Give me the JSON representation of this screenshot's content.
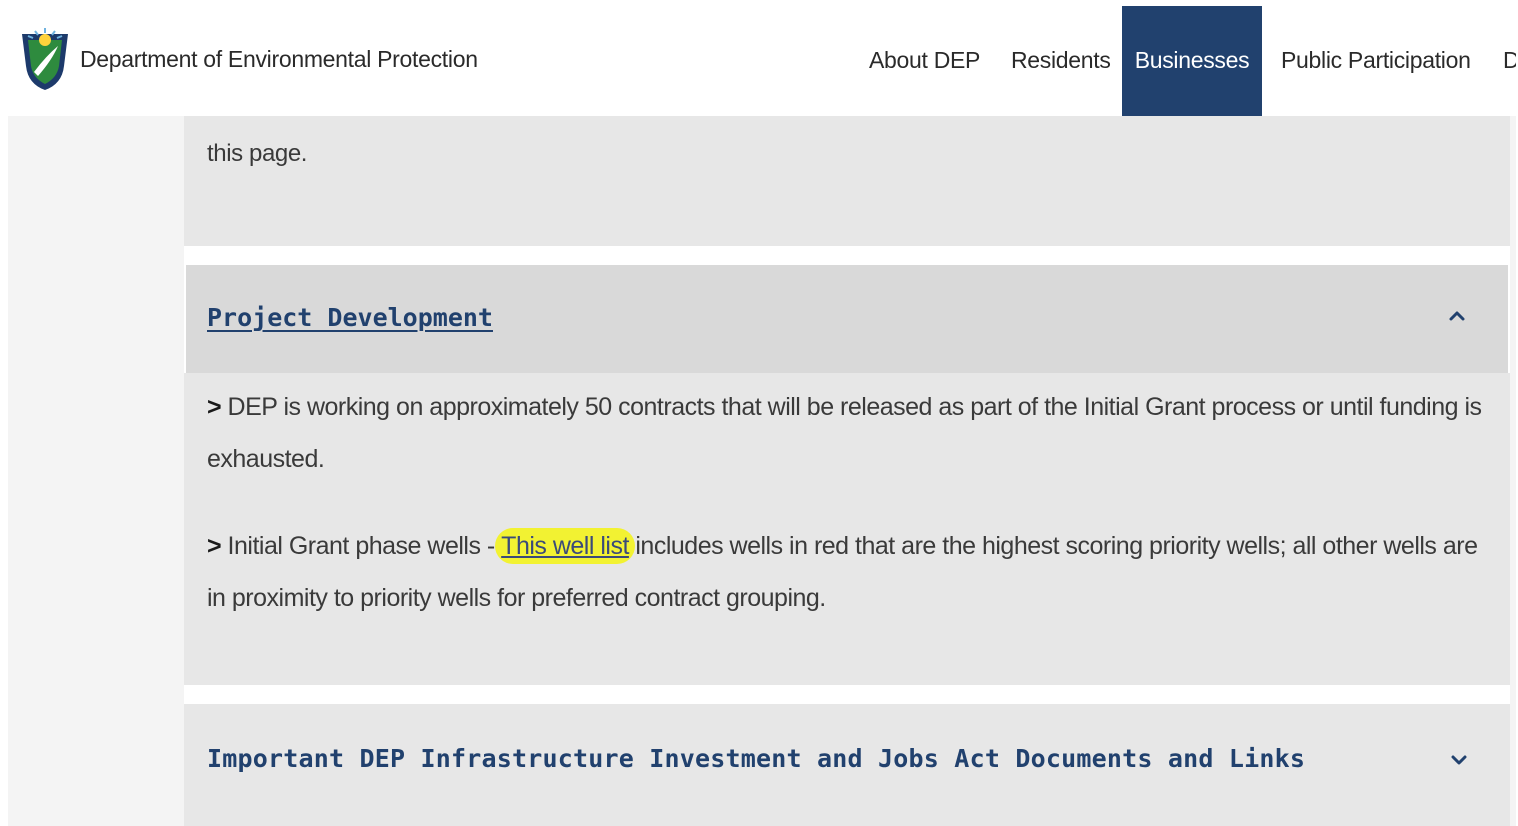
{
  "header": {
    "agency_name": "Department of Environmental Protection",
    "logo_icon": "pa-keystone-logo-icon",
    "nav": [
      {
        "label": "About DEP",
        "active": false
      },
      {
        "label": "Residents",
        "active": false
      },
      {
        "label": "Businesses",
        "active": true
      },
      {
        "label": "Public Participation",
        "active": false
      },
      {
        "label": "D",
        "active": false
      }
    ],
    "active_color": "#21416e"
  },
  "content": {
    "prev_section_tail": "this page.",
    "accordion": [
      {
        "title": "Project Development",
        "expanded": true,
        "toggle_icon": "chevron-up-icon",
        "paragraphs": [
          {
            "prefix": ">",
            "text": "DEP is working on approximately 50 contracts that will be released as part of the Initial Grant process or until funding is exhausted."
          },
          {
            "prefix": ">",
            "before_link": "Initial Grant phase wells - ",
            "link_text": "This well list",
            "after_link": " includes wells in red that are the highest scoring priority wells; all other wells are in proximity to priority wells for preferred contract grouping."
          }
        ]
      },
      {
        "title": "Important DEP Infrastructure Investment and Jobs Act Documents and Links",
        "expanded": false,
        "toggle_icon": "chevron-down-icon"
      }
    ],
    "highlight_color": "#f2f232"
  }
}
